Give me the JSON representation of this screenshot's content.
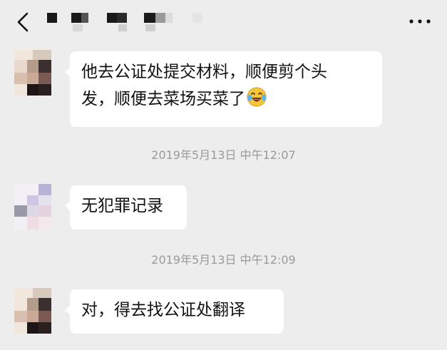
{
  "header": {
    "back_icon": "chevron-left-icon",
    "more_icon": "more-horizontal-icon",
    "title_pixelated": true
  },
  "messages": [
    {
      "type": "text",
      "line1": "他去公证处提交材料，顺便剪个头",
      "line2": "发，顺便去菜场买菜了",
      "emoji": "laughing-tears-emoji"
    },
    {
      "type": "timestamp",
      "text": "2019年5月13日 中午12:07"
    },
    {
      "type": "text",
      "text": "无犯罪记录"
    },
    {
      "type": "timestamp",
      "text": "2019年5月13日 中午12:09"
    },
    {
      "type": "text",
      "text": "对，得去找公证处翻译"
    }
  ],
  "colors": {
    "background": "#ededed",
    "bubble": "#ffffff",
    "text": "#111111",
    "timestamp": "#9a9a9a"
  }
}
